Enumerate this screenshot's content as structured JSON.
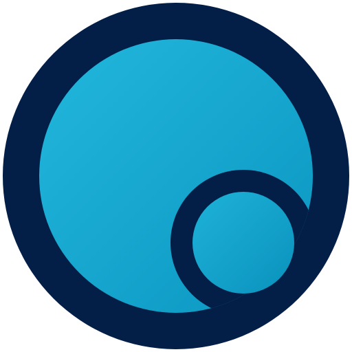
{
  "app_icon": {
    "name": "circle-in-circle-logo",
    "colors": {
      "ring": "#041f47",
      "fill_light": "#23b7dc",
      "fill_dark": "#0a96c1",
      "background": "#ffffff"
    }
  }
}
